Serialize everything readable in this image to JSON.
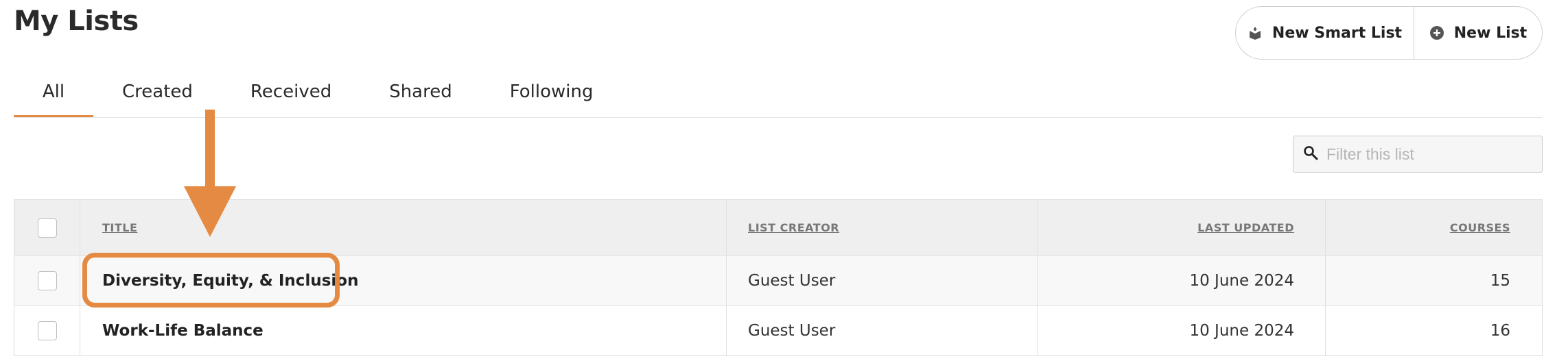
{
  "header": {
    "title": "My Lists",
    "new_smart_list_label": "New Smart List",
    "new_list_label": "New List"
  },
  "tabs": [
    {
      "label": "All",
      "active": true
    },
    {
      "label": "Created",
      "active": false
    },
    {
      "label": "Received",
      "active": false
    },
    {
      "label": "Shared",
      "active": false
    },
    {
      "label": "Following",
      "active": false
    }
  ],
  "filter": {
    "placeholder": "Filter this list",
    "value": "",
    "icon": "search-icon"
  },
  "table": {
    "columns": [
      "TITLE",
      "LIST CREATOR",
      "LAST UPDATED",
      "COURSES"
    ],
    "rows": [
      {
        "title": "Diversity, Equity, & Inclusion",
        "creator": "Guest User",
        "last_updated": "10 June 2024",
        "courses": "15",
        "checked": false
      },
      {
        "title": "Work-Life Balance",
        "creator": "Guest User",
        "last_updated": "10 June 2024",
        "courses": "16",
        "checked": false
      }
    ]
  },
  "colors": {
    "accent": "#e58a42",
    "header_bg": "#efefef",
    "border": "#dcdcdc"
  }
}
